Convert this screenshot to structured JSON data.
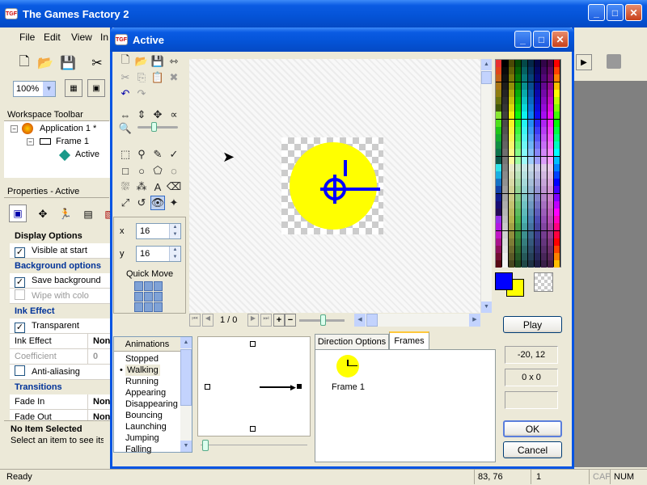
{
  "main_window": {
    "title": "The Games Factory 2",
    "menu": [
      "File",
      "Edit",
      "View",
      "In"
    ],
    "zoom": "100%"
  },
  "workspace": {
    "title": "Workspace Toolbar",
    "tree": {
      "application": "Application 1 *",
      "frame": "Frame 1",
      "object": "Active"
    }
  },
  "properties": {
    "title": "Properties - Active",
    "rows": [
      {
        "label": "Display Options",
        "type": "cat-dark"
      },
      {
        "label": "Visible at start",
        "type": "check",
        "checked": true
      },
      {
        "label": "Background options",
        "type": "cat"
      },
      {
        "label": "Save background",
        "type": "check",
        "checked": true
      },
      {
        "label": "Wipe with colo",
        "type": "check",
        "checked": false,
        "disabled": true
      },
      {
        "label": "Ink Effect",
        "type": "cat"
      },
      {
        "label": "Transparent",
        "type": "check",
        "checked": true
      },
      {
        "label": "Ink Effect",
        "type": "value",
        "value": "Non"
      },
      {
        "label": "Coefficient",
        "type": "value",
        "value": "0",
        "disabled": true
      },
      {
        "label": "Anti-aliasing",
        "type": "check",
        "checked": false
      },
      {
        "label": "Transitions",
        "type": "cat"
      },
      {
        "label": "Fade In",
        "type": "value",
        "value": "Non"
      },
      {
        "label": "Fade Out",
        "type": "value",
        "value": "Non"
      }
    ],
    "info_title": "No Item Selected",
    "info_text": "Select an item to see its d"
  },
  "editor": {
    "title": "Active",
    "x_label": "x",
    "x_value": "16",
    "y_label": "y",
    "y_value": "16",
    "quick_move": "Quick Move",
    "frame_counter": "1 / 0",
    "animations_header": "Animations",
    "animations": [
      "Stopped",
      "Walking",
      "Running",
      "Appearing",
      "Disappearing",
      "Bouncing",
      "Launching",
      "Jumping",
      "Falling"
    ],
    "selected_animation": "Walking",
    "tabs": [
      "Direction Options",
      "Frames"
    ],
    "active_tab": "Frames",
    "frame_label": "Frame 1",
    "play_button": "Play",
    "coords": "-20, 12",
    "size": "0 x 0",
    "empty_field": "",
    "ok_button": "OK",
    "cancel_button": "Cancel"
  },
  "colors": {
    "fg": "#0000ff",
    "bg": "#ffff00",
    "title_blue": "#0453d6",
    "sprite_yellow": "#ffff00",
    "sprite_line": "#0000ff"
  },
  "statusbar": {
    "ready": "Ready",
    "coords": "83, 76",
    "page": "1",
    "cap": "CAP",
    "num": "NUM"
  }
}
